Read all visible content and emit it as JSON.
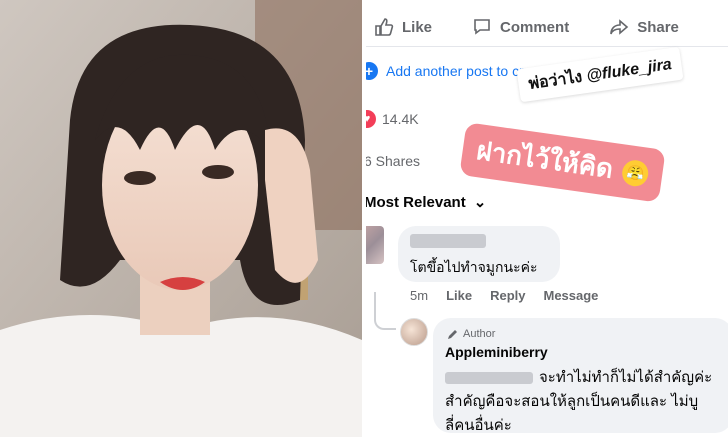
{
  "post_actions": {
    "like_label": "Like",
    "comment_label": "Comment",
    "share_label": "Share"
  },
  "add_post": {
    "label": "Add another post to creat"
  },
  "reactions": {
    "count": "14.4K"
  },
  "shares": {
    "label": "6 Shares"
  },
  "sort": {
    "label": "Most Relevant"
  },
  "stickers": {
    "caption_thai": "พ่อว่าไง",
    "mention": "@fluke_jira",
    "pink_text": "ฝากไว้ให้คิด"
  },
  "comment": {
    "text": "โตขึ้อไปทำจมูกนะค่ะ",
    "time": "5m",
    "like_label": "Like",
    "reply_label": "Reply",
    "message_label": "Message"
  },
  "reply": {
    "author_badge": "Author",
    "name": "Appleminiberry",
    "line1": "จะทำไม่ทำก็ไม่ได้สำคัญค่ะ",
    "line2": "สำคัญคือจะสอนให้ลูกเป็นคนดีและ ไม่บู",
    "line3": "ลี่คนอื่นค่ะ"
  },
  "colors": {
    "facebook_blue": "#1877f2",
    "sticker_pink": "#f28b93",
    "reaction_red": "#f33e58",
    "bubble_gray": "#f0f2f5"
  }
}
